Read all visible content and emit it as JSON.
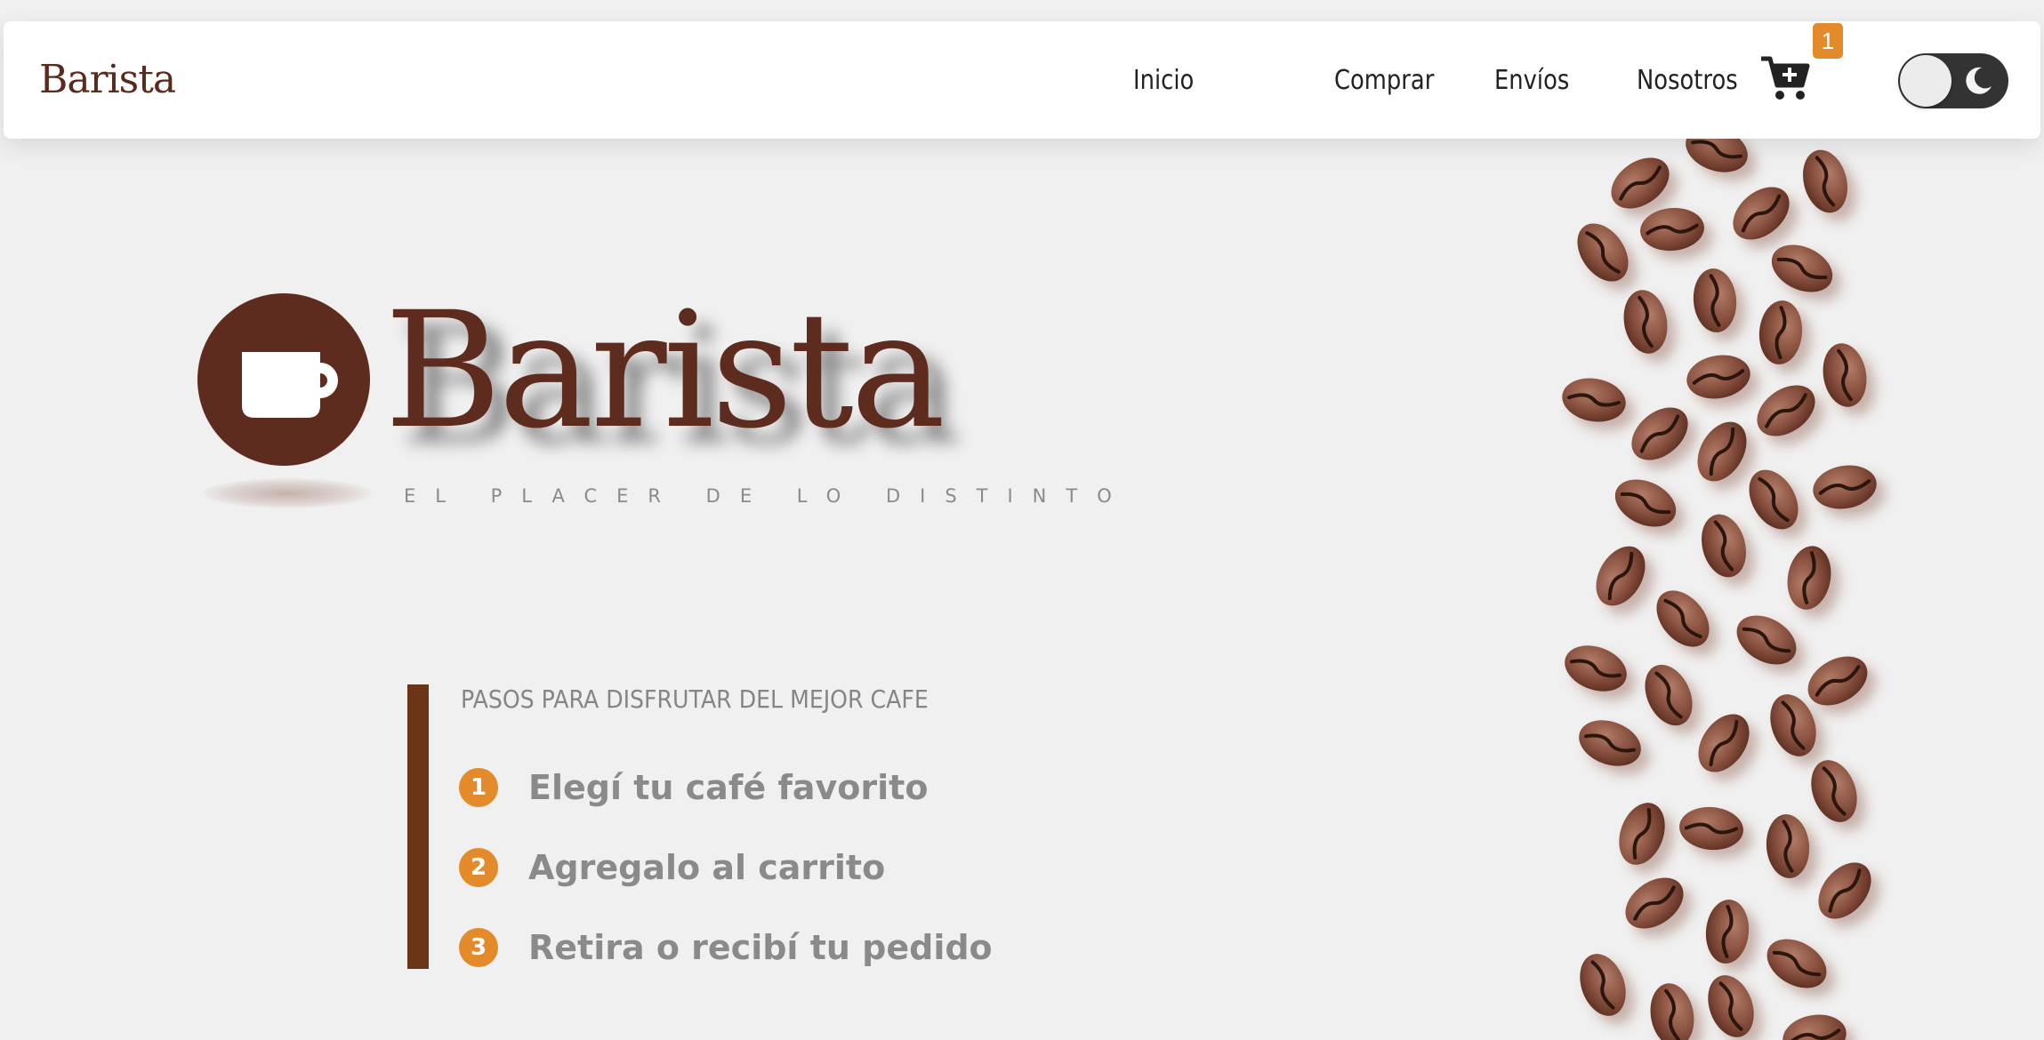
{
  "navbar": {
    "brand": "Barista",
    "links": [
      {
        "label": "Inicio"
      },
      {
        "label": "Comprar"
      },
      {
        "label": "Envíos"
      },
      {
        "label": "Nosotros"
      }
    ],
    "cart": {
      "icon": "cart-plus-icon",
      "badge_count": "1"
    },
    "theme_toggle": {
      "icon": "moon-icon",
      "state": "light"
    }
  },
  "hero": {
    "logo_word": "Barista",
    "tagline": "EL PLACER DE LO DISTINTO",
    "emblem_icon": "coffee-cup-icon"
  },
  "steps": {
    "title": "PASOS PARA DISFRUTAR DEL MEJOR CAFE",
    "items": [
      {
        "number": "1",
        "text": "Elegí tu café favorito"
      },
      {
        "number": "2",
        "text": "Agregalo al carrito"
      },
      {
        "number": "3",
        "text": "Retira o recibí tu pedido"
      }
    ]
  },
  "decoration": {
    "image": "coffee-beans-image"
  },
  "colors": {
    "brand_brown": "#5e2c1f",
    "accent_orange": "#e38a2a",
    "step_bar": "#6b3416",
    "background": "#f0f0f0"
  }
}
